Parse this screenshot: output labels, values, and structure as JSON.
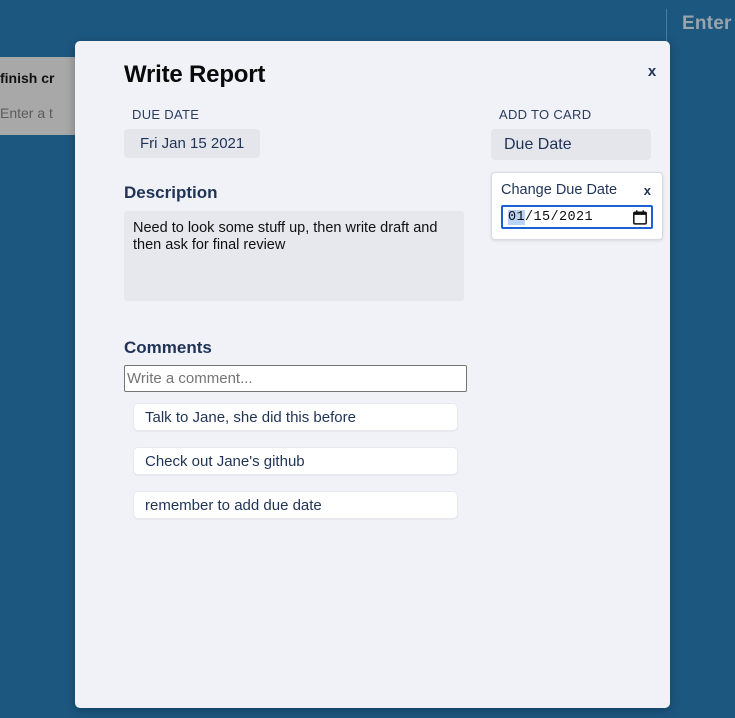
{
  "colors": {
    "app_background": "#1c5780",
    "modal_background": "#f0f2f7",
    "accent_navy": "#1f3356",
    "chip_gray": "#e4e6eb",
    "focus_blue": "#1a62d4",
    "selection_blue": "#b9d3f5",
    "bg_card_gray": "#a8a8a8"
  },
  "background_app": {
    "topbar": {
      "enter_label": "Enter",
      "divider_icon": "vertical-divider-icon"
    },
    "list_card": {
      "title": "finish cr",
      "input_placeholder": "Enter a t"
    }
  },
  "modal": {
    "title": "Write Report",
    "close_label": "x",
    "close_icon": "close-icon",
    "due_date": {
      "label": "DUE DATE",
      "value": "Fri Jan 15 2021"
    },
    "description": {
      "heading": "Description",
      "value": "Need to look some stuff up, then write draft and then ask for final review"
    },
    "comments": {
      "heading": "Comments",
      "input_value": "",
      "input_placeholder": "Write a comment...",
      "items": [
        {
          "text": "Talk to Jane, she did this before"
        },
        {
          "text": "Check out Jane's github"
        },
        {
          "text": "remember to add due date"
        }
      ]
    },
    "add_to_card": {
      "label": "ADD TO CARD",
      "due_date_button": "Due Date"
    },
    "due_date_popup": {
      "title": "Change Due Date",
      "close_label": "x",
      "close_icon": "close-icon",
      "date_value": "01/15/2021",
      "date_month_segment": "01",
      "date_rest_segment": "/15/2021",
      "calendar_icon": "calendar-icon"
    }
  }
}
